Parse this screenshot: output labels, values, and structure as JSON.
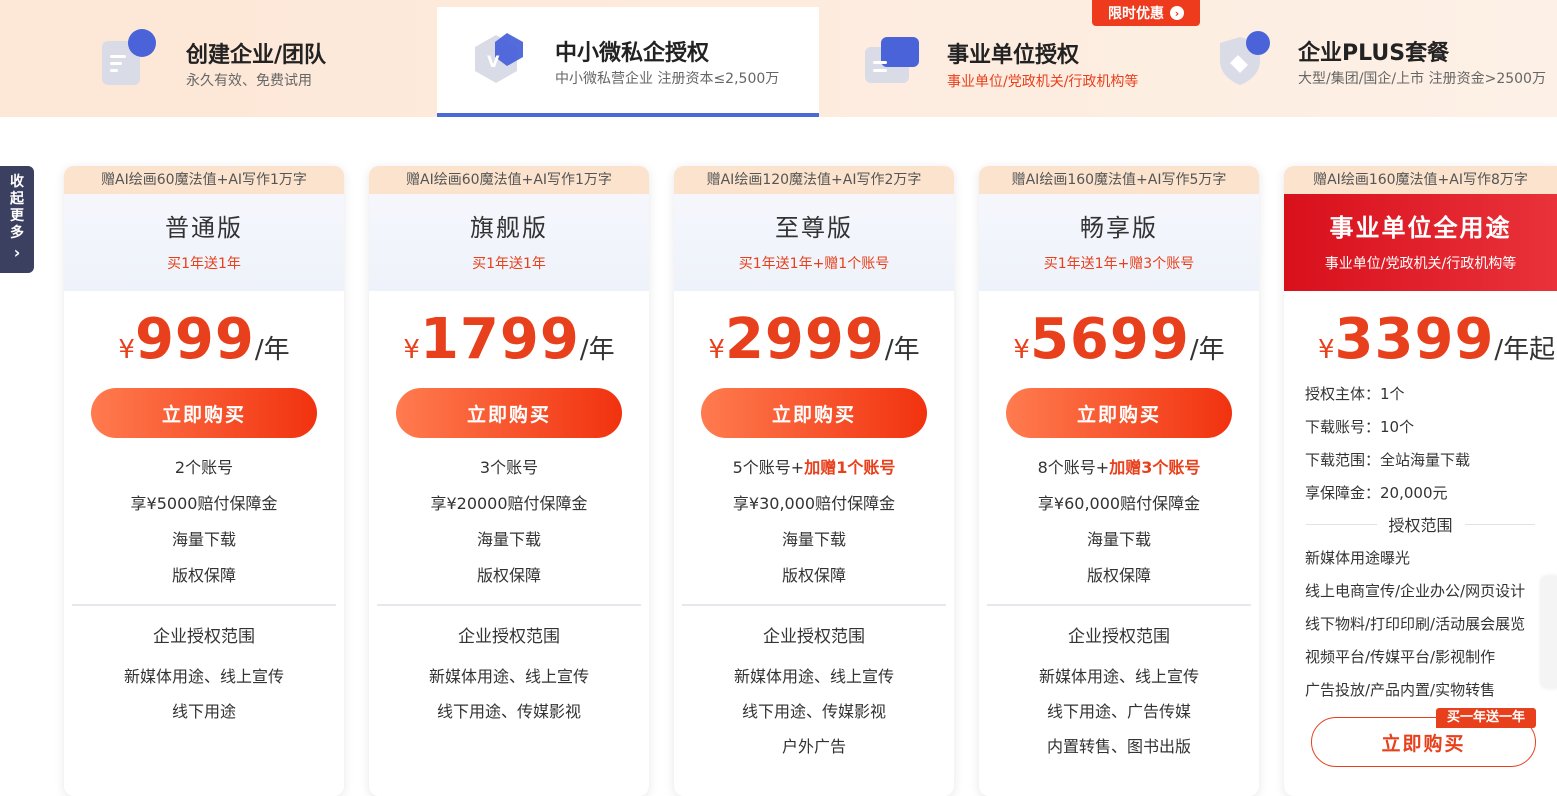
{
  "tabs": [
    {
      "title": "创建企业/团队",
      "sub": "永久有效、免费试用",
      "icon": "doc-icon",
      "active": false
    },
    {
      "title": "中小微私企授权",
      "sub": "中小微私营企业 注册资本≤2,500万",
      "icon": "v-badge-icon",
      "active": true
    },
    {
      "title": "事业单位授权",
      "sub": "事业单位/党政机关/行政机构等",
      "icon": "gov-card-icon",
      "active": false
    },
    {
      "title": "企业PLUS套餐",
      "sub": "大型/集团/国企/上市 注册资金>2500万",
      "icon": "shield-icon",
      "active": false
    }
  ],
  "promo_badge": "限时优惠",
  "side_panel": {
    "label": "收起更多"
  },
  "cards": [
    {
      "gift": "赠AI绘画60魔法值+AI写作1万字",
      "name": "普通版",
      "promo": "买1年送1年",
      "currency": "¥",
      "price": "999",
      "unit": "/年",
      "buy_label": "立即购买",
      "features": [
        "2个账号",
        "享¥5000赔付保障金",
        "海量下载",
        "版权保障"
      ],
      "scope_title": "企业授权范围",
      "scope": [
        "新媒体用途、线上宣传",
        "线下用途"
      ]
    },
    {
      "gift": "赠AI绘画60魔法值+AI写作1万字",
      "name": "旗舰版",
      "promo": "买1年送1年",
      "currency": "¥",
      "price": "1799",
      "unit": "/年",
      "buy_label": "立即购买",
      "features": [
        "3个账号",
        "享¥20000赔付保障金",
        "海量下载",
        "版权保障"
      ],
      "scope_title": "企业授权范围",
      "scope": [
        "新媒体用途、线上宣传",
        "线下用途、传媒影视"
      ]
    },
    {
      "gift": "赠AI绘画120魔法值+AI写作2万字",
      "name": "至尊版",
      "promo": "买1年送1年+赠1个账号",
      "currency": "¥",
      "price": "2999",
      "unit": "/年",
      "buy_label": "立即购买",
      "features": [
        "享¥30,000赔付保障金",
        "海量下载",
        "版权保障"
      ],
      "account_base": "5个账号+",
      "account_bonus": "加赠1个账号",
      "scope_title": "企业授权范围",
      "scope": [
        "新媒体用途、线上宣传",
        "线下用途、传媒影视",
        "户外广告"
      ]
    },
    {
      "gift": "赠AI绘画160魔法值+AI写作5万字",
      "name": "畅享版",
      "promo": "买1年送1年+赠3个账号",
      "currency": "¥",
      "price": "5699",
      "unit": "/年",
      "buy_label": "立即购买",
      "features": [
        "享¥60,000赔付保障金",
        "海量下载",
        "版权保障"
      ],
      "account_base": "8个账号+",
      "account_bonus": "加赠3个账号",
      "scope_title": "企业授权范围",
      "scope": [
        "新媒体用途、线上宣传",
        "线下用途、广告传媒",
        "内置转售、图书出版"
      ]
    }
  ],
  "gov_card": {
    "gift": "赠AI绘画160魔法值+AI写作8万字",
    "name": "事业单位全用途",
    "promo": "事业单位/党政机关/行政机构等",
    "currency": "¥",
    "price": "3399",
    "unit": "/年起",
    "details": [
      "授权主体：1个",
      "下载账号：10个",
      "下载范围：全站海量下载",
      "享保障金：20,000元"
    ],
    "scope_title": "授权范围",
    "scope": [
      "新媒体用途曝光",
      "线上电商宣传/企业办公/网页设计",
      "线下物料/打印印刷/活动展会展览",
      "视频平台/传媒平台/影视制作",
      "广告投放/产品内置/实物转售"
    ],
    "badge": "买一年送一年",
    "buy_label": "立即购买"
  }
}
